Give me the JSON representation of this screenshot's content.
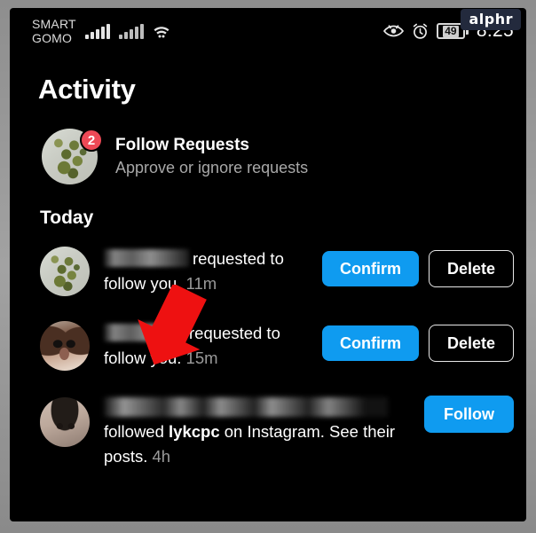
{
  "watermark": {
    "text": "alphr"
  },
  "status_bar": {
    "carrier_line1": "SMART",
    "carrier_line2": "GOMO",
    "signal_1_icon": "cellular-signal-icon",
    "signal_2_icon": "cellular-signal-secondary-icon",
    "wifi_icon": "wifi-icon",
    "eye_comfort_icon": "eye-comfort-icon",
    "alarm_icon": "alarm-clock-icon",
    "battery_percent": "49",
    "time": "8:25"
  },
  "header": {
    "title": "Activity"
  },
  "follow_requests": {
    "avatar_name": "follow-requests-avatar",
    "badge_count": "2",
    "title": "Follow Requests",
    "subtitle": "Approve or ignore requests"
  },
  "sections": [
    {
      "label": "Today"
    }
  ],
  "activity": [
    {
      "avatar_name": "plant-avatar",
      "username_blurred": true,
      "text_before": "",
      "text_main": "requested to follow you.",
      "time": "11m",
      "buttons": [
        {
          "label": "Confirm",
          "style": "primary"
        },
        {
          "label": "Delete",
          "style": "outline"
        }
      ]
    },
    {
      "avatar_name": "dog-avatar",
      "username_blurred": true,
      "text_before": "",
      "text_main": "requested to follow you.",
      "time": "15m",
      "buttons": [
        {
          "label": "Confirm",
          "style": "primary"
        },
        {
          "label": "Delete",
          "style": "outline"
        }
      ]
    },
    {
      "avatar_name": "person-avatar",
      "username_blurred": true,
      "text_prefix": "followed ",
      "bold_name": "lykcpc",
      "text_suffix": " on Instagram. See their posts.",
      "time": "4h",
      "buttons": [
        {
          "label": "Follow",
          "style": "primary"
        }
      ]
    }
  ],
  "annotation": {
    "arrow_icon": "red-down-left-arrow-annotation",
    "color": "#ee1111"
  },
  "colors": {
    "background": "#000000",
    "accent_blue": "#0f9bf0",
    "badge_red": "#ed4956",
    "muted_text": "#a8a8a8",
    "frame_gray": "#9a9a9a"
  }
}
